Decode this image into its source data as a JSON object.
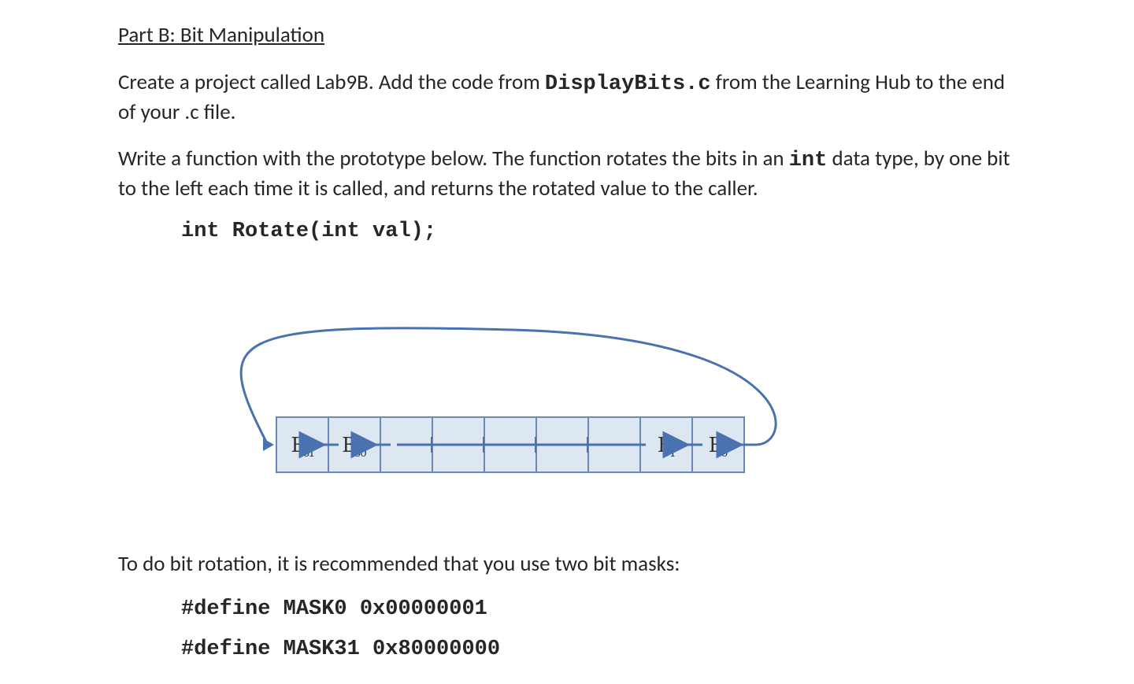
{
  "heading": "Part B: Bit Manipulation",
  "para1_a": "Create a project called Lab9B.  Add the code from ",
  "para1_code": "DisplayBits.c",
  "para1_b": " from the Learning Hub to the end of your .c file.",
  "para2_a": "Write a function with the prototype below.  The function rotates the bits in an ",
  "para2_code": "int",
  "para2_b": " data type, by one bit to the left each time it is called, and returns the rotated value to the caller.",
  "prototype": "int Rotate(int val);",
  "diagram": {
    "b31": "B",
    "b31_sub": "31",
    "b30": "B",
    "b30_sub": "30",
    "b1": "B",
    "b1_sub": "1",
    "b0": "B",
    "b0_sub": "0"
  },
  "para3": "To do bit rotation, it is recommended that you use two bit masks:",
  "mask0": "#define MASK0 0x00000001",
  "mask31": "#define MASK31 0x80000000"
}
